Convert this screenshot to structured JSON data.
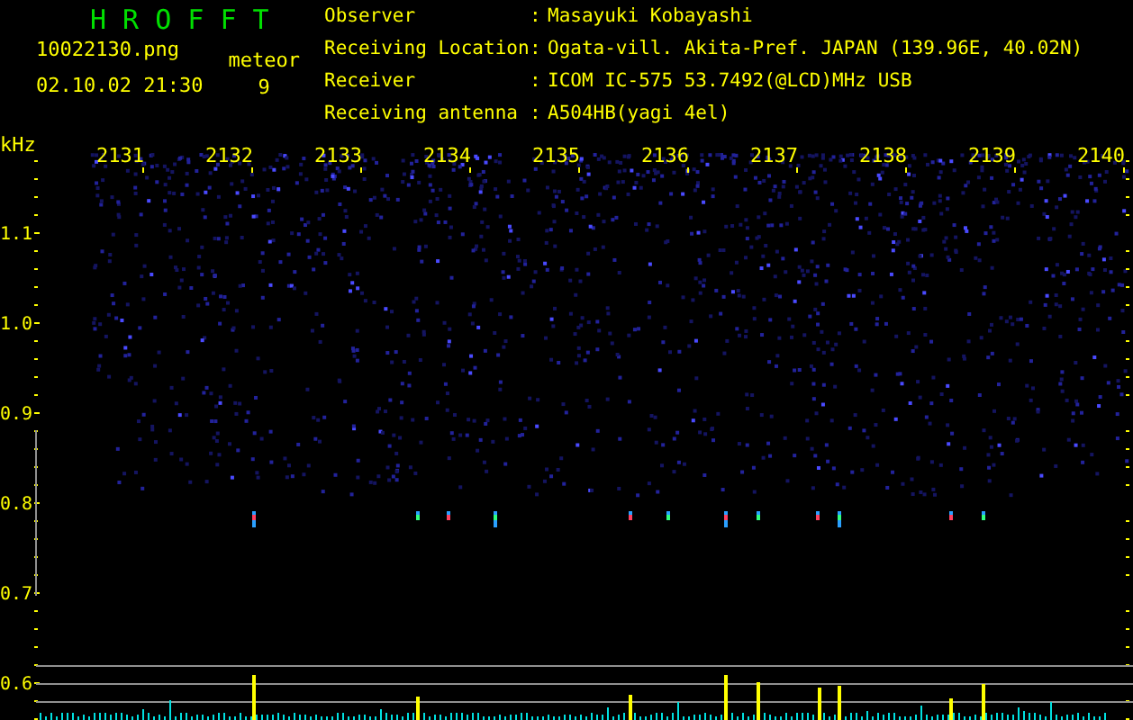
{
  "header": {
    "title": "H R O F F T",
    "file_name": "10022130.png",
    "date_time": "02.10.02 21:30",
    "meteor_label": "meteor",
    "meteor_count": "9"
  },
  "info": [
    {
      "label": "Observer",
      "colon": ":",
      "value": "Masayuki Kobayashi"
    },
    {
      "label": "Receiving Location",
      "colon": ":",
      "value": "Ogata-vill. Akita-Pref. JAPAN (139.96E, 40.02N)"
    },
    {
      "label": "Receiver",
      "colon": ":",
      "value": "ICOM IC-575 53.7492(@LCD)MHz USB"
    },
    {
      "label": "Receiving antenna",
      "colon": ":",
      "value": "A504HB(yagi 4el)"
    }
  ],
  "plot": {
    "unit": "kHz",
    "time_labels": [
      "2131",
      "2132",
      "2133",
      "2134",
      "2135",
      "2136",
      "2137",
      "2138",
      "2139",
      "2140"
    ],
    "frequency_labels": [
      "1.1",
      "1.0",
      "0.9",
      "0.8",
      "0.7",
      "0.6"
    ]
  }
}
